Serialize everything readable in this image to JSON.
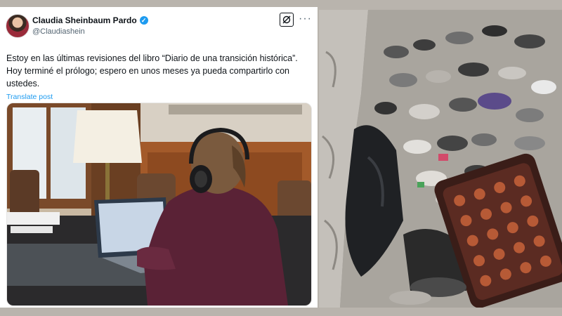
{
  "tweet": {
    "display_name": "Claudia Sheinbaum Pardo",
    "handle": "@Claudiashein",
    "text": "Estoy en las últimas revisiones del libro “Diario de una transición histórica”. Hoy terminé el prólogo; espero en unos meses ya pueda compartirlo con ustedes.",
    "translate_label": "Translate post",
    "more_label": "···"
  },
  "icons": {
    "verified": "verified-badge-icon",
    "grok": "grok-icon",
    "more": "more-options-icon"
  },
  "colors": {
    "link": "#1d9bf0",
    "text": "#0f1419",
    "muted": "#536471"
  }
}
